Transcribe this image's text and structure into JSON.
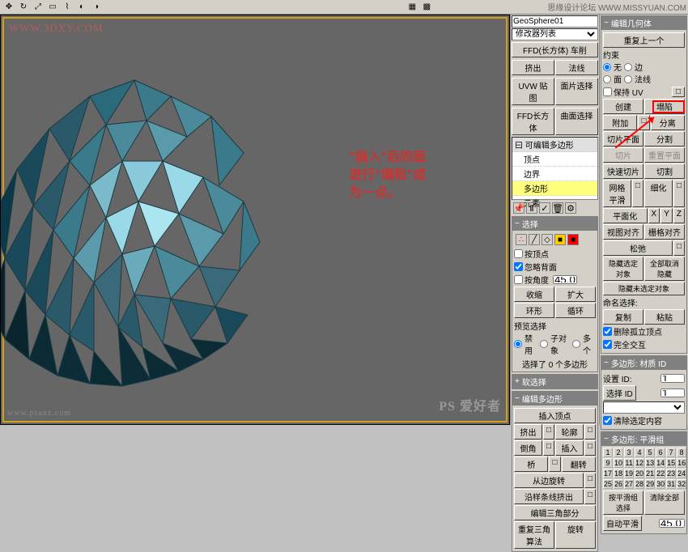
{
  "toolbar_title_right": "思缘设计论坛  WWW.MISSYUAN.COM",
  "watermarks": {
    "tl": "WWW.3DXY.COM",
    "bl": "www.psanz.com",
    "br": "PS 爱好者"
  },
  "annotation": [
    "\"插入\"后的面",
    "进行\"塌陷\"成",
    "为一点。"
  ],
  "left_panel": {
    "object_name": "GeoSphere01",
    "modifier_list": "修改器列表",
    "ffd": "FFD(长方体)  车削",
    "extrude": "挤出",
    "lathe": "法线",
    "uvw": "UVW 贴图",
    "editmesh": "面片选择",
    "ffd_box": "FFD长方体",
    "curve": "曲面选择",
    "stack_header": "曰 可编辑多边形",
    "stack_items": [
      "顶点",
      "边界",
      "多边形",
      "元素"
    ],
    "sel_hdr": "选择",
    "by_vertex": "按顶点",
    "ignore_back": "忽略背面",
    "by_angle": "按角度",
    "angle_val": "45.0",
    "shrink": "收缩",
    "grow": "扩大",
    "ring": "环形",
    "loop": "循环",
    "preview_sel": "预览选择",
    "preview_opts": [
      "禁用",
      "子对象",
      "多个"
    ],
    "sel_count": "选择了 0 个多边形",
    "soft_sel": "软选择",
    "edit_poly": "编辑多边形",
    "insert_vertex": "插入顶点",
    "extrude_b": "挤出",
    "outline": "轮廓",
    "bevel": "倒角",
    "inset": "插入",
    "bridge": "桥",
    "flip": "翻转",
    "hinge": "从边旋转",
    "extrude_spline": "沿样条线挤出",
    "edit_tri": "编辑三角部分",
    "retri": "重复三角算法",
    "turn": "旋转"
  },
  "right_panel": {
    "edit_geo": "编辑几何体",
    "repeat": "重复上一个",
    "constrain": "约束",
    "none": "无",
    "edge": "边",
    "face": "面",
    "normal": "法线",
    "preserve_uv": "保持 UV",
    "create": "创建",
    "collapse": "塌陷",
    "attach": "附加",
    "detach": "分离",
    "slice_plane": "切片平面",
    "slice": "分割",
    "slice_b": "切片",
    "reset_plane": "重置平面",
    "quickslice": "快速切片",
    "cut": "切割",
    "msmooth": "网格平滑",
    "tess": "细化",
    "planarize": "平面化",
    "view_align": "视图对齐",
    "grid_align": "栅格对齐",
    "relax": "松弛",
    "hide_sel": "隐藏选定对象",
    "unhide_all": "全部取消隐藏",
    "hide_unsel": "隐藏未选定对象",
    "named_sel": "命名选择:",
    "copy": "复制",
    "paste": "粘贴",
    "del_iso": "删除孤立顶点",
    "full_inter": "完全交互",
    "poly_matid": "多边形: 材质 ID",
    "set_id": "设置 ID:",
    "id_val": "1",
    "select_id": "选择 ID",
    "id_sel_val": "1",
    "clear_sel": "清除选定内容",
    "poly_smooth": "多边形: 平滑组",
    "nums": [
      "1",
      "2",
      "3",
      "4",
      "5",
      "6",
      "7",
      "8",
      "9",
      "10",
      "11",
      "12",
      "13",
      "14",
      "15",
      "16",
      "17",
      "18",
      "19",
      "20",
      "21",
      "22",
      "23",
      "24",
      "25",
      "26",
      "27",
      "28",
      "29",
      "30",
      "31",
      "32"
    ],
    "by_smooth": "按平滑组选择",
    "clear_all": "清除全部",
    "auto_smooth": "自动平滑",
    "auto_val": "45.0"
  }
}
